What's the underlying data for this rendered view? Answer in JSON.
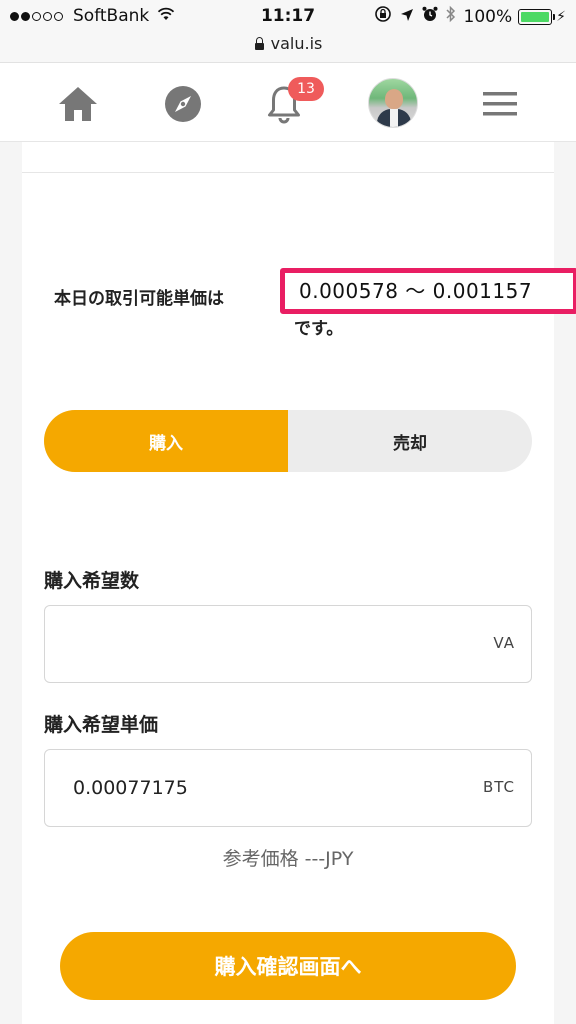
{
  "status_bar": {
    "carrier": "SoftBank",
    "time": "11:17",
    "battery": "100%"
  },
  "url_bar": {
    "domain": "valu.is"
  },
  "nav": {
    "notification_count": "13"
  },
  "trade": {
    "range_prefix": "本日の取引可能単価は",
    "range_value": "0.000578 〜 0.001157",
    "range_suffix": "です。",
    "toggle": {
      "buy_label": "購入",
      "sell_label": "売却",
      "active": "buy"
    },
    "quantity": {
      "label": "購入希望数",
      "value": "",
      "unit": "VA"
    },
    "price": {
      "label": "購入希望単価",
      "value": "0.00077175",
      "unit": "BTC"
    },
    "reference_price": "参考価格 ---JPY",
    "confirm_label": "購入確認画面へ"
  },
  "colors": {
    "accent": "#f5a800",
    "highlight": "#e91e63",
    "badge": "#ef5b5b"
  }
}
